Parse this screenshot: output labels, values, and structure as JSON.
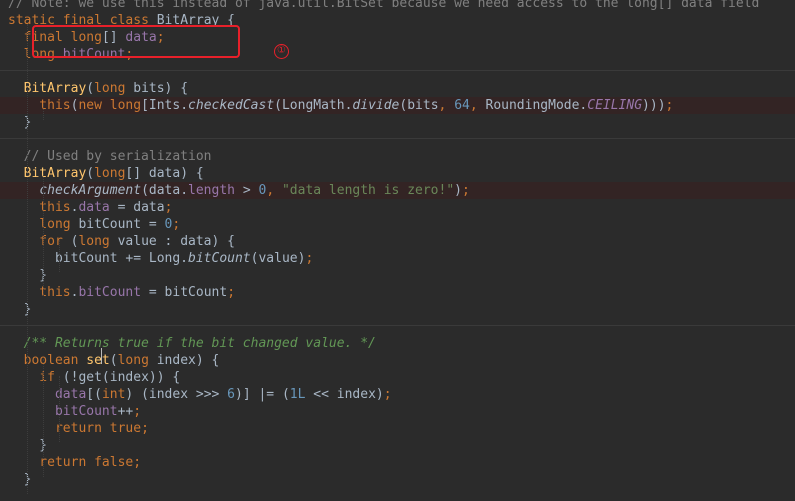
{
  "editor": {
    "lines": [
      {
        "tokens": [
          {
            "t": "// Note: we use this instead of java.util.BitSet because we need access to the long[] data field",
            "c": "cmt"
          }
        ]
      },
      {
        "tokens": [
          {
            "t": "static ",
            "c": "kw"
          },
          {
            "t": "final ",
            "c": "kw"
          },
          {
            "t": "class ",
            "c": "kw"
          },
          {
            "t": "BitArray {",
            "c": ""
          }
        ]
      },
      {
        "tokens": [
          {
            "t": "  final ",
            "c": "kw"
          },
          {
            "t": "long",
            "c": "kw"
          },
          {
            "t": "[] ",
            "c": ""
          },
          {
            "t": "data",
            "c": "fld"
          },
          {
            "t": ";",
            "c": "kw"
          }
        ]
      },
      {
        "tokens": [
          {
            "t": "  long ",
            "c": "kw"
          },
          {
            "t": "bitCount",
            "c": "fld"
          },
          {
            "t": ";",
            "c": "kw"
          }
        ]
      },
      {
        "tokens": []
      },
      {
        "tokens": [
          {
            "t": "  BitArray",
            "c": "fn"
          },
          {
            "t": "(",
            "c": ""
          },
          {
            "t": "long ",
            "c": "kw"
          },
          {
            "t": "bits) {",
            "c": ""
          }
        ]
      },
      {
        "hl": true,
        "tokens": [
          {
            "t": "    this",
            "c": "kw"
          },
          {
            "t": "(",
            "c": ""
          },
          {
            "t": "new ",
            "c": "kw"
          },
          {
            "t": "long",
            "c": "kw"
          },
          {
            "t": "[Ints.",
            "c": ""
          },
          {
            "t": "checkedCast",
            "c": "ital"
          },
          {
            "t": "(LongMath.",
            "c": ""
          },
          {
            "t": "divide",
            "c": "ital"
          },
          {
            "t": "(bits",
            "c": ""
          },
          {
            "t": ", ",
            "c": "kw"
          },
          {
            "t": "64",
            "c": "num"
          },
          {
            "t": ", ",
            "c": "kw"
          },
          {
            "t": "RoundingMode.",
            "c": ""
          },
          {
            "t": "CEILING",
            "c": "fldit"
          },
          {
            "t": ")))",
            "c": ""
          },
          {
            "t": ";",
            "c": "kw"
          }
        ]
      },
      {
        "tokens": [
          {
            "t": "  }",
            "c": ""
          }
        ]
      },
      {
        "tokens": []
      },
      {
        "tokens": [
          {
            "t": "  // Used by serialization",
            "c": "cmt"
          }
        ]
      },
      {
        "tokens": [
          {
            "t": "  BitArray",
            "c": "fn"
          },
          {
            "t": "(",
            "c": ""
          },
          {
            "t": "long",
            "c": "kw"
          },
          {
            "t": "[] data) {",
            "c": ""
          }
        ]
      },
      {
        "hl": true,
        "tokens": [
          {
            "t": "    ",
            "c": ""
          },
          {
            "t": "checkArgument",
            "c": "ital"
          },
          {
            "t": "(data.",
            "c": ""
          },
          {
            "t": "length ",
            "c": "fld"
          },
          {
            "t": "> ",
            "c": ""
          },
          {
            "t": "0",
            "c": "num"
          },
          {
            "t": ", ",
            "c": "kw"
          },
          {
            "t": "\"data length is zero!\"",
            "c": "str"
          },
          {
            "t": ")",
            "c": ""
          },
          {
            "t": ";",
            "c": "kw"
          }
        ]
      },
      {
        "tokens": [
          {
            "t": "    this",
            "c": "kw"
          },
          {
            "t": ".",
            "c": ""
          },
          {
            "t": "data ",
            "c": "fld"
          },
          {
            "t": "= data",
            "c": ""
          },
          {
            "t": ";",
            "c": "kw"
          }
        ]
      },
      {
        "tokens": [
          {
            "t": "    long ",
            "c": "kw"
          },
          {
            "t": "bitCount = ",
            "c": ""
          },
          {
            "t": "0",
            "c": "num"
          },
          {
            "t": ";",
            "c": "kw"
          }
        ]
      },
      {
        "tokens": [
          {
            "t": "    for ",
            "c": "kw"
          },
          {
            "t": "(",
            "c": ""
          },
          {
            "t": "long ",
            "c": "kw"
          },
          {
            "t": "value : data) {",
            "c": ""
          }
        ]
      },
      {
        "tokens": [
          {
            "t": "      bitCount += Long.",
            "c": ""
          },
          {
            "t": "bitCount",
            "c": "ital"
          },
          {
            "t": "(value)",
            "c": ""
          },
          {
            "t": ";",
            "c": "kw"
          }
        ]
      },
      {
        "tokens": [
          {
            "t": "    }",
            "c": ""
          }
        ]
      },
      {
        "tokens": [
          {
            "t": "    this",
            "c": "kw"
          },
          {
            "t": ".",
            "c": ""
          },
          {
            "t": "bitCount ",
            "c": "fld"
          },
          {
            "t": "= bitCount",
            "c": ""
          },
          {
            "t": ";",
            "c": "kw"
          }
        ]
      },
      {
        "tokens": [
          {
            "t": "  }",
            "c": ""
          }
        ]
      },
      {
        "tokens": []
      },
      {
        "tokens": [
          {
            "t": "  /** Returns true if the bit changed value. */",
            "c": "doc"
          }
        ]
      },
      {
        "tokens": [
          {
            "t": "  boolean ",
            "c": "kw"
          },
          {
            "t": "set",
            "c": "fn"
          },
          {
            "t": "(",
            "c": ""
          },
          {
            "t": "long ",
            "c": "kw"
          },
          {
            "t": "index) {",
            "c": ""
          }
        ]
      },
      {
        "tokens": [
          {
            "t": "    if ",
            "c": "kw"
          },
          {
            "t": "(!get(index)) {",
            "c": ""
          }
        ]
      },
      {
        "tokens": [
          {
            "t": "      data",
            "c": "fld"
          },
          {
            "t": "[(",
            "c": ""
          },
          {
            "t": "int",
            "c": "kw"
          },
          {
            "t": ") (index >>> ",
            "c": ""
          },
          {
            "t": "6",
            "c": "num"
          },
          {
            "t": ")] |= (",
            "c": ""
          },
          {
            "t": "1L ",
            "c": "num"
          },
          {
            "t": "<< index)",
            "c": ""
          },
          {
            "t": ";",
            "c": "kw"
          }
        ]
      },
      {
        "tokens": [
          {
            "t": "      bitCount",
            "c": "fld"
          },
          {
            "t": "++",
            "c": ""
          },
          {
            "t": ";",
            "c": "kw"
          }
        ]
      },
      {
        "tokens": [
          {
            "t": "      return true",
            "c": "kw"
          },
          {
            "t": ";",
            "c": "kw"
          }
        ]
      },
      {
        "tokens": [
          {
            "t": "    }",
            "c": ""
          }
        ]
      },
      {
        "tokens": [
          {
            "t": "    return false",
            "c": "kw"
          },
          {
            "t": ";",
            "c": "kw"
          }
        ]
      },
      {
        "tokens": [
          {
            "t": "  }",
            "c": ""
          }
        ]
      },
      {
        "tokens": []
      }
    ]
  },
  "annotation": {
    "badge_label": "①",
    "color": "#e8202a"
  },
  "colors": {
    "background": "#2b2b2b",
    "keyword": "#cc7832",
    "field": "#9876aa",
    "number": "#6897bb",
    "string": "#6a8759",
    "comment": "#808080",
    "doc_comment": "#629755",
    "method_decl": "#ffc66d",
    "default_text": "#a9b7c6",
    "error_line_bg": "#332424"
  }
}
